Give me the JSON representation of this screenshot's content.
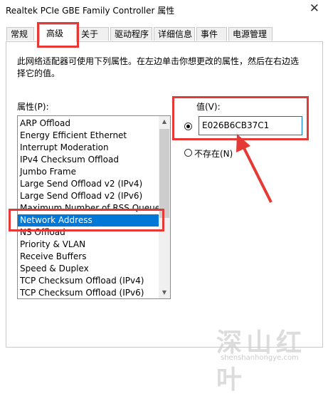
{
  "window": {
    "title": "Realtek PCIe GBE Family Controller 属性",
    "close_glyph": "✕"
  },
  "tabs": [
    {
      "label": "常规"
    },
    {
      "label": "高级"
    },
    {
      "label": "关于"
    },
    {
      "label": "驱动程序"
    },
    {
      "label": "详细信息"
    },
    {
      "label": "事件"
    },
    {
      "label": "电源管理"
    }
  ],
  "active_tab": "高级",
  "advanced": {
    "description": "此网络适配器可使用下列属性。在左边单击你想更改的属性，然后在右边选择它的值。",
    "property_label": "属性(P):",
    "properties": [
      "ARP Offload",
      "Energy Efficient Ethernet",
      "Interrupt Moderation",
      "IPv4 Checksum Offload",
      "Jumbo Frame",
      "Large Send Offload v2 (IPv4)",
      "Large Send Offload v2 (IPv6)",
      "Maximum Number of RSS Queue",
      "Network Address",
      "NS Offload",
      "Priority & VLAN",
      "Receive Buffers",
      "Speed & Duplex",
      "TCP Checksum Offload (IPv4)",
      "TCP Checksum Offload (IPv6)"
    ],
    "selected_property": "Network Address",
    "value_label": "值(V):",
    "value": "E026B6CB37C1",
    "not_present_label": "不存在(N)",
    "value_radio_selected": true
  },
  "scrollbar": {
    "up_glyph": "▲",
    "down_glyph": "▼"
  },
  "watermark": {
    "cn": "深山红叶",
    "en": "shenshanhongye.com"
  },
  "annotation_color": "#e53935",
  "accent_color": "#0078d7"
}
